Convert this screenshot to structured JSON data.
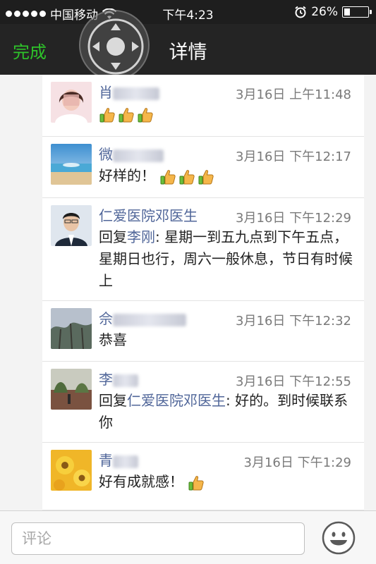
{
  "status": {
    "carrier": "中国移动",
    "time": "下午4:23",
    "battery": "26%",
    "battery_level": 0.26
  },
  "nav": {
    "done_label": "完成",
    "title": "详情"
  },
  "comments": [
    {
      "name": "肖",
      "timestamp": "3月16日 上午11:48",
      "text": "",
      "thumbs": 3
    },
    {
      "name": "微",
      "timestamp": "3月16日 下午12:17",
      "text": "好样的！",
      "thumbs": 3
    },
    {
      "name": "仁爱医院邓医生",
      "timestamp": "3月16日 下午12:29",
      "reply_prefix": "回复",
      "reply_to": "李刚",
      "reply_text": ": 星期一到五九点到下午五点，星期日也行，周六一般休息，节日有时候上"
    },
    {
      "name": "佘",
      "timestamp": "3月16日 下午12:32",
      "text": "恭喜"
    },
    {
      "name": "李",
      "timestamp": "3月16日 下午12:55",
      "reply_prefix": "回复",
      "reply_to": "仁爱医院邓医生",
      "reply_text": ": 好的。到时候联系你"
    },
    {
      "name": "青",
      "timestamp": "3月16日 下午1:29",
      "text": "好有成就感！",
      "thumbs": 1
    }
  ],
  "comment_bar": {
    "placeholder": "评论"
  },
  "colors": {
    "accent_green": "#2ec32a",
    "name_blue": "#506699",
    "nav_bg": "#242424"
  },
  "icons": [
    "wifi-icon",
    "alarm-icon",
    "battery-icon",
    "assistive-touch-icon",
    "thumbs-up-icon",
    "smiley-icon"
  ]
}
